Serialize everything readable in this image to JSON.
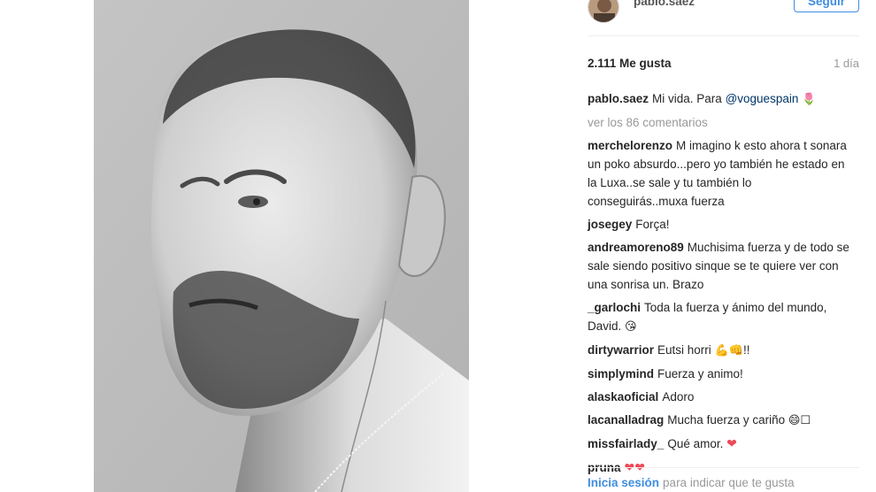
{
  "post": {
    "username": "pablo.saez",
    "follow_label": "Seguir",
    "likes": "2.111 Me gusta",
    "age": "1 día",
    "caption_user": "pablo.saez",
    "caption_text": "Mi vida. Para",
    "caption_mention": "@voguespain",
    "caption_emoji": "🌷",
    "view_all": "ver los 86 comentarios"
  },
  "comments": [
    {
      "user": "merchelorenzo",
      "text": "M imagino k esto ahora t sonara un poko absurdo...pero yo también he estado en la Luxa..se sale y tu también lo conseguirás..muxa fuerza"
    },
    {
      "user": "josegey",
      "text": "Força!"
    },
    {
      "user": "andreamoreno89",
      "text": "Muchisima fuerza y de todo se sale siendo positivo sinque se te quiere ver con una sonrisa un. Brazo"
    },
    {
      "user": "_garlochi",
      "text": "Toda la fuerza y ánimo del mundo, David.",
      "emoji": "😘"
    },
    {
      "user": "dirtywarrior",
      "text": "Eutsi horri",
      "emoji": "💪👊",
      "suffix": "!!"
    },
    {
      "user": "simplymind",
      "text": "Fuerza y animo!"
    },
    {
      "user": "alaskaoficial",
      "text": "Adoro"
    },
    {
      "user": "lacanalladrag",
      "text": "Mucha fuerza y cariño",
      "emoji": "😄☐"
    },
    {
      "user": "missfairlady_",
      "text": "Qué amor.",
      "heart": "❤"
    },
    {
      "user": "pruna",
      "text": "",
      "heart": "❤❤"
    }
  ],
  "footer": {
    "login": "Inicia sesión",
    "text": "para indicar que te gusta"
  },
  "colors": {
    "accent": "#3f8de0",
    "heart": "#ed4956",
    "muted": "#999999"
  }
}
